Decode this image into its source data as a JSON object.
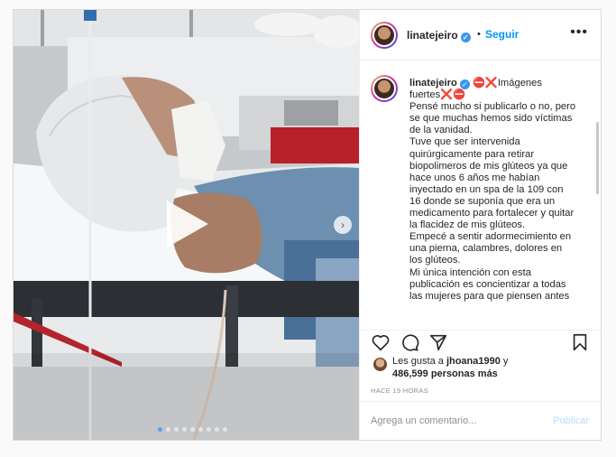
{
  "post": {
    "username": "linatejeiro",
    "follow_label": "Seguir",
    "dot_separator": "•",
    "more_icon": "more-horizontal-icon",
    "verified_icon": "verified-badge-icon",
    "video_control": "play-icon",
    "next_control": "chevron-right-icon",
    "next_glyph": "›",
    "carousel": {
      "total": 9,
      "active": 0
    }
  },
  "caption": {
    "username": "linatejeiro",
    "headline": "⛔❌Imágenes fuertes❌⛔",
    "paragraphs": [
      "Pensé mucho si publicarlo o no, pero se que muchas hemos sido víctimas de la vanidad.",
      "Tuve que ser intervenida quirúrgicamente para retirar biopolimeros de mis glúteos ya que hace unos 6 años me habían inyectado en un spa de la 109 con 16 donde se suponía que era un medicamento para fortalecer y quitar la flacidez de mis glúteos.",
      "Empecé a sentir adormecimiento en una pierna, calambres, dolores en los glúteos.",
      "Mi única intención con esta publicación es concientizar a todas las mujeres para que piensen antes"
    ]
  },
  "actions": {
    "like_icon": "heart-icon",
    "comment_icon": "comment-icon",
    "share_icon": "share-icon",
    "save_icon": "bookmark-icon"
  },
  "likes": {
    "prefix": "Les gusta a",
    "first_user": "jhoana1990",
    "and": "y",
    "count": "486,599 personas más"
  },
  "timestamp": "HACE 19 HORAS",
  "comment": {
    "placeholder": "Agrega un comentario...",
    "publish_label": "Publicar"
  },
  "colors": {
    "link": "#0095f6",
    "publish_disabled": "#b3dbff",
    "carousel_active": "#4fa3ff"
  }
}
